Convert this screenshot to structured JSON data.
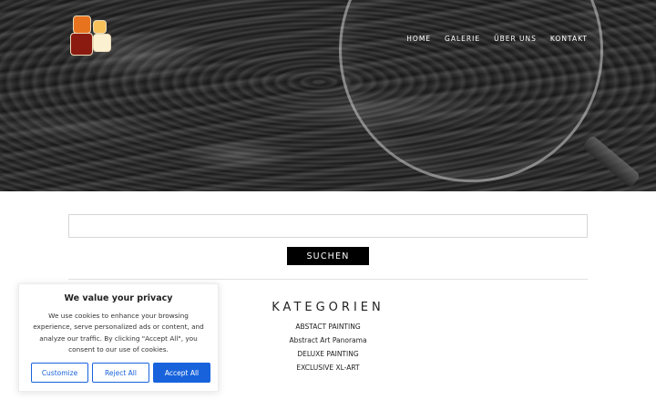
{
  "nav": {
    "items": [
      {
        "label": "HOME"
      },
      {
        "label": "GALERIE"
      },
      {
        "label": "ÜBER UNS"
      },
      {
        "label": "KONTAKT"
      }
    ]
  },
  "search": {
    "placeholder": "",
    "value": "",
    "button_label": "SUCHEN"
  },
  "categories": {
    "title": "KATEGORIEN",
    "items": [
      {
        "label": "ABSTACT PAINTING"
      },
      {
        "label": "Abstract Art Panorama"
      },
      {
        "label": "DELUXE PAINTING"
      },
      {
        "label": "EXCLUSIVE XL-ART"
      }
    ]
  },
  "cookie_banner": {
    "title": "We value your privacy",
    "text": "We use cookies to enhance your browsing experience, serve personalized ads or content, and analyze our traffic. By clicking \"Accept All\", you consent to our use of cookies.",
    "customize_label": "Customize",
    "reject_label": "Reject All",
    "accept_label": "Accept All"
  },
  "colors": {
    "accent": "#1863dc",
    "button_dark": "#000000",
    "logo": [
      "#e8731f",
      "#f7c15a",
      "#8b1a10",
      "#fbf0d0"
    ]
  },
  "icons": {
    "logo": "stacked-squares-logo",
    "hero": "magnifying-glass-over-abstract-art"
  }
}
